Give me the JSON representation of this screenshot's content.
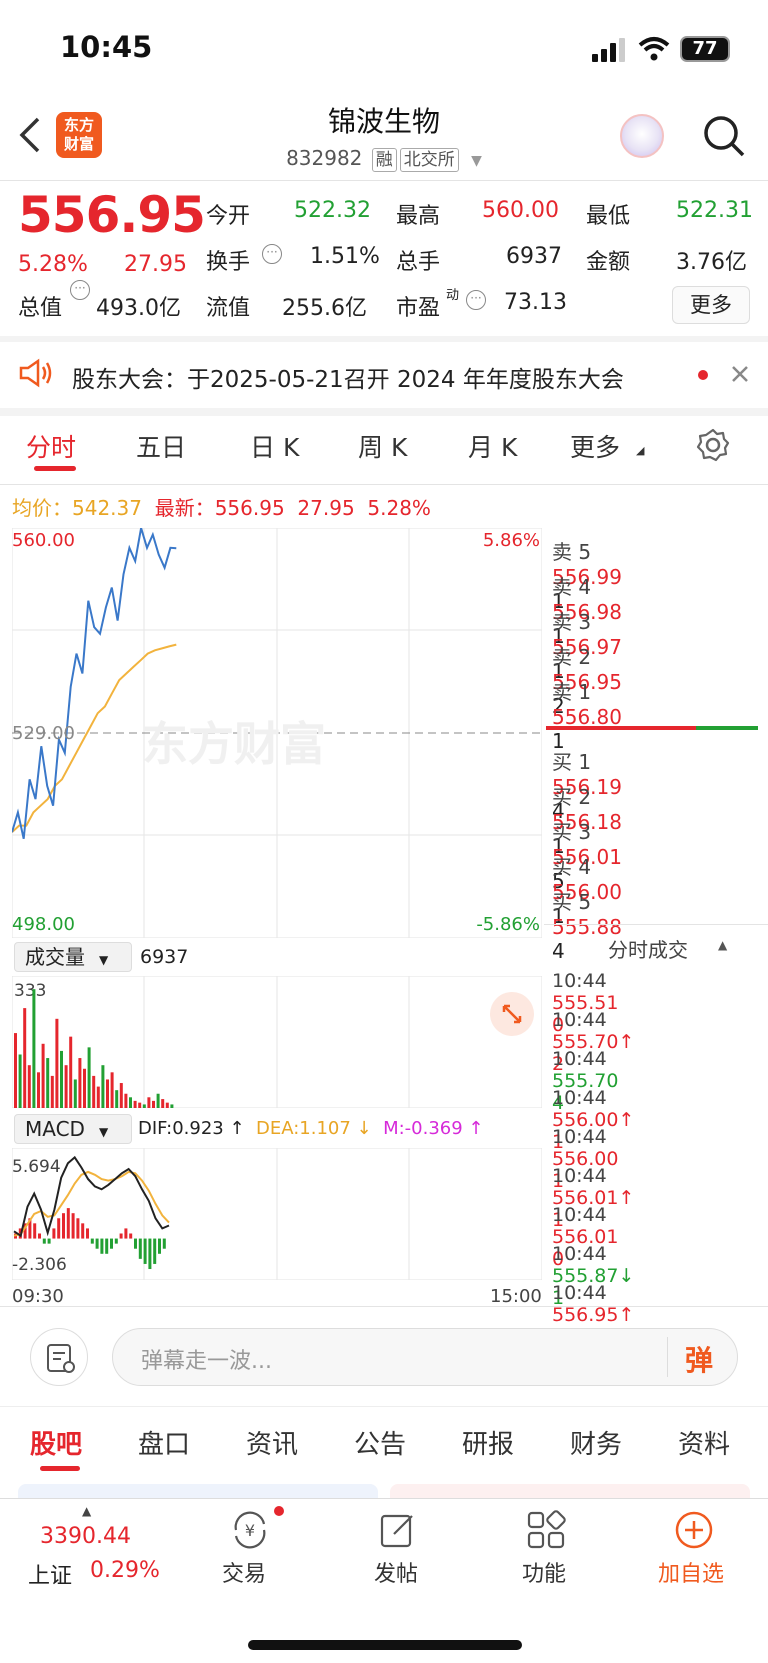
{
  "status": {
    "time": "10:45",
    "battery": "77"
  },
  "header": {
    "name": "锦波生物",
    "code": "832982",
    "tag1": "融",
    "tag2": "北交所"
  },
  "logo": {
    "line1": "东方",
    "line2": "财富"
  },
  "quote": {
    "price": "556.95",
    "pct": "5.28%",
    "chg": "27.95",
    "open_l": "今开",
    "open": "522.32",
    "high_l": "最高",
    "high": "560.00",
    "low_l": "最低",
    "low": "522.31",
    "turn_l": "换手",
    "turn": "1.51%",
    "vol_l": "总手",
    "vol": "6937",
    "amt_l": "金额",
    "amt": "3.76亿",
    "mcap_l": "总值",
    "mcap": "493.0亿",
    "fcap_l": "流值",
    "fcap": "255.6亿",
    "pe_l": "市盈",
    "pe_sup": "动",
    "pe": "73.13",
    "more": "更多"
  },
  "notice": {
    "text": "股东大会：于2025-05-21召开 2024 年年度股东大会"
  },
  "tabs": [
    "分时",
    "五日",
    "日 K",
    "周 K",
    "月 K",
    "更多"
  ],
  "chart_info": {
    "avg_label": "均价：",
    "avg": "542.37",
    "last_label": "最新：",
    "last": "556.95",
    "chg": "27.95",
    "pct": "5.28%"
  },
  "chart_data": {
    "type": "line",
    "y_axis": {
      "top": "560.00",
      "mid": "529.00",
      "bottom": "498.00",
      "top_pct": "5.86%",
      "bottom_pct": "-5.86%"
    },
    "x_axis": {
      "start": "09:30",
      "end": "15:00"
    },
    "series": [
      {
        "values": [
          514,
          517,
          513,
          522,
          519,
          527,
          521,
          518,
          528,
          526,
          536,
          541,
          538,
          549,
          545,
          544,
          548,
          551,
          546,
          553,
          557,
          555,
          560,
          557,
          559,
          556,
          554,
          557,
          556.95
        ]
      },
      {
        "values": [
          514,
          515,
          515,
          517,
          518,
          519,
          521,
          522,
          524,
          526,
          528,
          530,
          532,
          533,
          535,
          537,
          538,
          539,
          540,
          541,
          541.5,
          541.8,
          542.1,
          542.37
        ]
      }
    ],
    "watermark": "东方财富"
  },
  "volume": {
    "label": "成交量",
    "total": "6937",
    "max": "333",
    "values": [
      210,
      150,
      280,
      120,
      333,
      100,
      180,
      140,
      90,
      250,
      160,
      120,
      200,
      80,
      140,
      110,
      170,
      90,
      60,
      120,
      80,
      100,
      50,
      70,
      40,
      30,
      20,
      15,
      10,
      30,
      20,
      40,
      25,
      15,
      10
    ]
  },
  "macd": {
    "label": "MACD",
    "dif": "DIF:0.923 ↑",
    "dea": "DEA:1.107 ↓",
    "m": "M:-0.369 ↑",
    "max": "5.694",
    "min": "-2.306",
    "dif_vals": [
      0.5,
      0.2,
      2.2,
      3.1,
      2.0,
      0.4,
      2.0,
      4.2,
      5.2,
      5.6,
      4.9,
      4.1,
      3.6,
      3.4,
      3.7,
      4.1,
      4.5,
      4.8,
      4.3,
      3.4,
      2.6,
      1.4,
      0.7,
      0.9
    ],
    "dea_vals": [
      0.2,
      0.3,
      1.0,
      1.7,
      1.9,
      1.5,
      1.6,
      2.3,
      3.0,
      3.8,
      4.4,
      4.6,
      4.4,
      4.1,
      4.0,
      4.1,
      4.3,
      4.6,
      4.5,
      4.0,
      3.3,
      2.4,
      1.6,
      1.1
    ],
    "hist": [
      1,
      2,
      3,
      4,
      3,
      1,
      -1,
      -1,
      2,
      4,
      5,
      6,
      5,
      4,
      3,
      2,
      -1,
      -2,
      -3,
      -3,
      -2,
      -1,
      1,
      2,
      1,
      -2,
      -4,
      -5,
      -6,
      -5,
      -3,
      -2
    ]
  },
  "orderbook": {
    "asks": [
      {
        "l": "卖 5",
        "p": "556.99",
        "v": "1"
      },
      {
        "l": "卖 4",
        "p": "556.98",
        "v": "1"
      },
      {
        "l": "卖 3",
        "p": "556.97",
        "v": "1"
      },
      {
        "l": "卖 2",
        "p": "556.95",
        "v": "2"
      },
      {
        "l": "卖 1",
        "p": "556.80",
        "v": "1"
      }
    ],
    "bids": [
      {
        "l": "买 1",
        "p": "556.19",
        "v": "4"
      },
      {
        "l": "买 2",
        "p": "556.18",
        "v": "1"
      },
      {
        "l": "买 3",
        "p": "556.01",
        "v": "5"
      },
      {
        "l": "买 4",
        "p": "556.00",
        "v": "1"
      },
      {
        "l": "买 5",
        "p": "555.88",
        "v": "4"
      }
    ]
  },
  "trades": {
    "title": "分时成交",
    "rows": [
      {
        "t": "10:44",
        "p": "555.51",
        "a": "",
        "v": "0",
        "c": "red"
      },
      {
        "t": "10:44",
        "p": "555.70",
        "a": "↑",
        "v": "2",
        "c": "red"
      },
      {
        "t": "10:44",
        "p": "555.70",
        "a": "",
        "v": "4",
        "c": "green"
      },
      {
        "t": "10:44",
        "p": "556.00",
        "a": "↑",
        "v": "1",
        "c": "red"
      },
      {
        "t": "10:44",
        "p": "556.00",
        "a": "",
        "v": "1",
        "c": "red"
      },
      {
        "t": "10:44",
        "p": "556.01",
        "a": "↑",
        "v": "1",
        "c": "red"
      },
      {
        "t": "10:44",
        "p": "556.01",
        "a": "",
        "v": "0",
        "c": "red"
      },
      {
        "t": "10:44",
        "p": "555.87",
        "a": "↓",
        "v": "1",
        "c": "green"
      },
      {
        "t": "10:44",
        "p": "556.95",
        "a": "↑",
        "v": "2",
        "c": "red"
      }
    ]
  },
  "comment": {
    "placeholder": "弹幕走一波...",
    "btn": "弹"
  },
  "content_tabs": [
    "股吧",
    "盘口",
    "资讯",
    "公告",
    "研报",
    "财务",
    "资料"
  ],
  "bottom_nav": {
    "index_value": "3390.44",
    "index_name": "上证",
    "index_pct": "0.29%",
    "items": [
      "交易",
      "发帖",
      "功能",
      "加自选"
    ]
  }
}
